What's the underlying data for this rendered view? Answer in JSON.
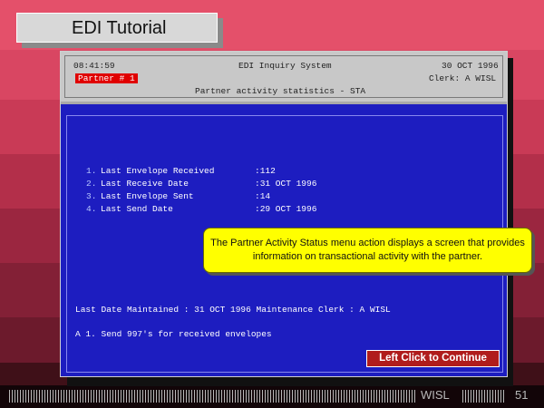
{
  "tutorial": {
    "title": "EDI Tutorial",
    "callout_text": "The Partner Activity Status menu action displays a screen that provides information on transactional activity with the partner.",
    "continue_label": "Left Click to Continue"
  },
  "terminal": {
    "time": "08:41:59",
    "system_name": "EDI Inquiry System",
    "date": "30 OCT 1996",
    "partner_badge": "Partner # 1",
    "clerk": "Clerk: A WISL",
    "screen_title": "Partner activity statistics - STA",
    "stats": [
      {
        "num": "1.",
        "label": "Last Envelope Received",
        "value": ":112"
      },
      {
        "num": "2.",
        "label": "Last Receive Date",
        "value": ":31 OCT 1996"
      },
      {
        "num": "3.",
        "label": "Last Envelope Sent",
        "value": ":14"
      },
      {
        "num": "4.",
        "label": "Last Send Date",
        "value": ":29 OCT 1996"
      }
    ],
    "maintenance_line": "Last Date Maintained : 31 OCT 1996 Maintenance Clerk : A WISL",
    "option_line": "A 1. Send 997's for received envelopes"
  },
  "footer": {
    "brand": "WISL",
    "page_number": "51"
  }
}
